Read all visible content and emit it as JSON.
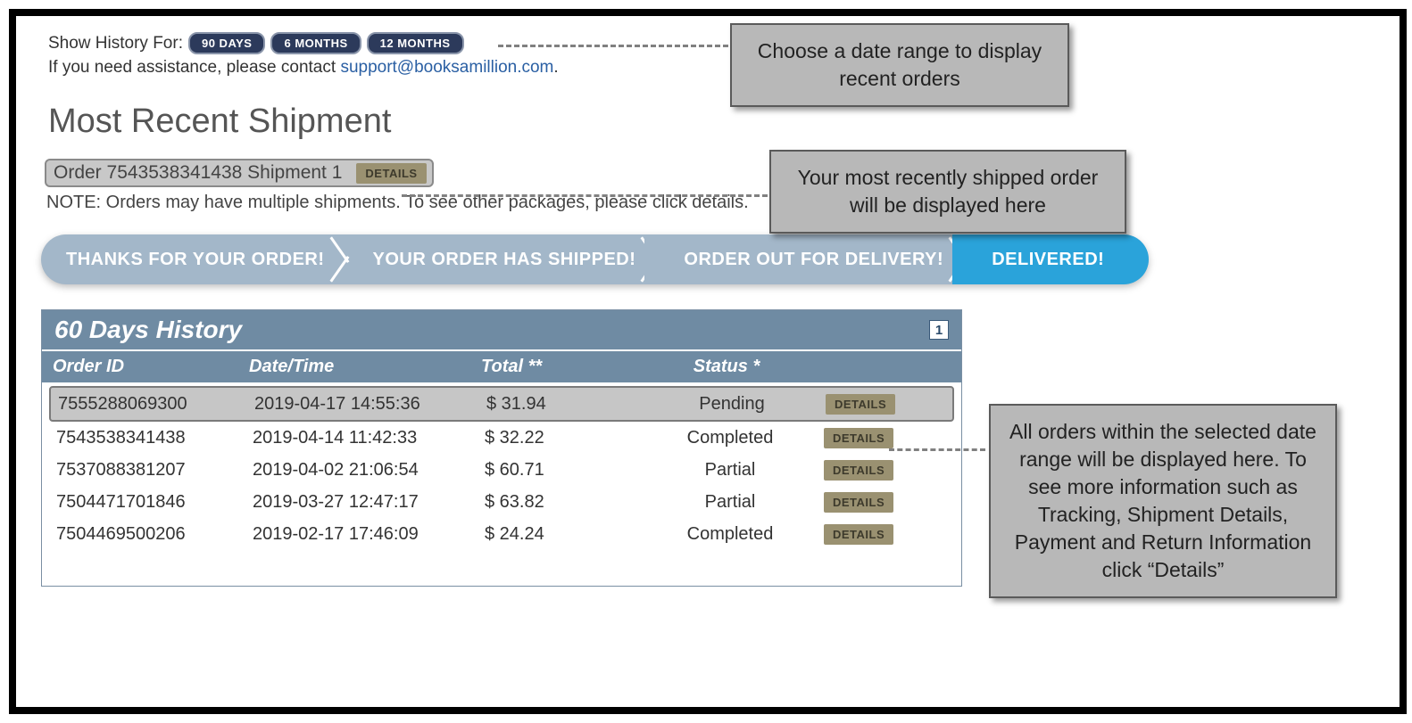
{
  "filter": {
    "label": "Show History For:",
    "options": [
      "90 DAYS",
      "6 MONTHS",
      "12 MONTHS"
    ]
  },
  "assist": {
    "prefix": "If you need assistance, please contact ",
    "email": "support@booksamillion.com",
    "suffix": "."
  },
  "heading": "Most Recent Shipment",
  "order_line": {
    "text": "Order 7543538341438 Shipment 1",
    "details": "DETAILS"
  },
  "note": "NOTE: Orders may have multiple shipments. To see other packages, please click details.",
  "steps": [
    "THANKS FOR YOUR ORDER!",
    "YOUR ORDER HAS SHIPPED!",
    "ORDER OUT FOR DELIVERY!",
    "DELIVERED!"
  ],
  "history": {
    "title": "60 Days History",
    "page": "1",
    "columns": [
      "Order ID",
      "Date/Time",
      "Total **",
      "Status *"
    ],
    "details_label": "DETAILS",
    "rows": [
      {
        "id": "7555288069300",
        "dt": "2019-04-17 14:55:36",
        "total": "$ 31.94",
        "status": "Pending",
        "hl": true
      },
      {
        "id": "7543538341438",
        "dt": "2019-04-14 11:42:33",
        "total": "$ 32.22",
        "status": "Completed",
        "hl": false
      },
      {
        "id": "7537088381207",
        "dt": "2019-04-02 21:06:54",
        "total": "$ 60.71",
        "status": "Partial",
        "hl": false
      },
      {
        "id": "7504471701846",
        "dt": "2019-03-27 12:47:17",
        "total": "$ 63.82",
        "status": "Partial",
        "hl": false
      },
      {
        "id": "7504469500206",
        "dt": "2019-02-17 17:46:09",
        "total": "$ 24.24",
        "status": "Completed",
        "hl": false
      }
    ]
  },
  "callouts": {
    "c1": "Choose a date range to display recent orders",
    "c2": "Your most recently shipped order will be displayed here",
    "c3": "All orders within the selected date range will be displayed here. To see more information such as Tracking, Shipment Details, Payment and Return Information click “Details”"
  }
}
